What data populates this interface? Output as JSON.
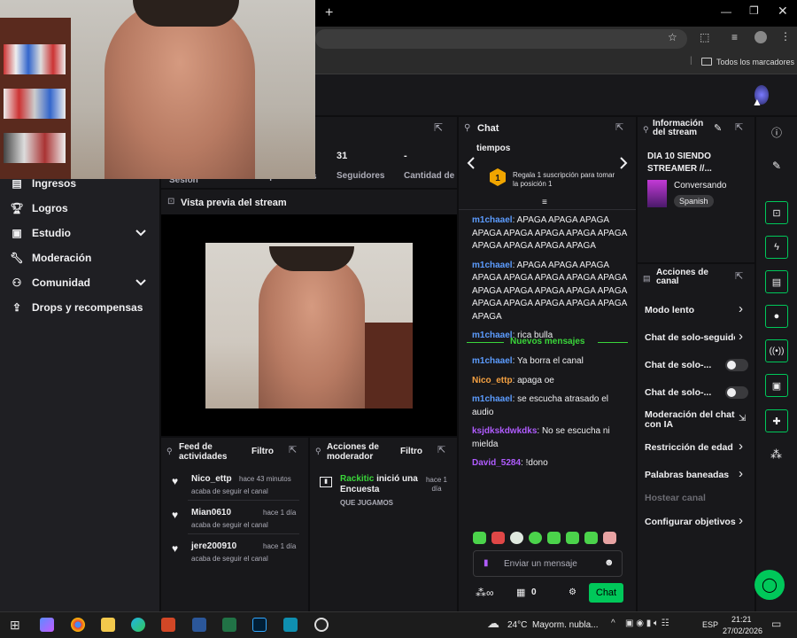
{
  "browser": {
    "new_tab_icon": "plus-icon",
    "bookmarks_label": "Todos los marcadores"
  },
  "stats": {
    "session_label": "Sesión",
    "spectators_label": "Espectadores",
    "followers_value": "31",
    "followers_label": "Seguidores",
    "subs_value": "-",
    "subs_label": "Cantidad de suscripciones"
  },
  "sidebar": {
    "items": [
      {
        "label": "Ingresos",
        "icon": "revenue-icon"
      },
      {
        "label": "Logros",
        "icon": "trophy-icon"
      },
      {
        "label": "Estudio",
        "icon": "studio-icon"
      },
      {
        "label": "Moderación",
        "icon": "wrench-icon"
      },
      {
        "label": "Comunidad",
        "icon": "community-icon"
      },
      {
        "label": "Drops y recompensas",
        "icon": "drops-icon"
      }
    ]
  },
  "preview": {
    "title": "Vista previa del stream"
  },
  "activity": {
    "title": "Feed de actividades",
    "filter_label": "Filtro",
    "items": [
      {
        "user": "Nico_ettp",
        "time": "hace 43 minutos",
        "action": "acaba de seguir el canal"
      },
      {
        "user": "Mian0610",
        "time": "hace 1 día",
        "action": "acaba de seguir el canal"
      },
      {
        "user": "jere200910",
        "time": "hace 1 día",
        "action": "acaba de seguir el canal"
      }
    ]
  },
  "mod_actions": {
    "title": "Acciones de moderador",
    "filter_label": "Filtro",
    "user": "Rackitic",
    "action": "inició una Encuesta",
    "time": "hace 1 día",
    "detail": "QUE JUGAMOS"
  },
  "chat": {
    "title": "Chat",
    "top_partial": "tiempos",
    "promo_text": "Regala 1 suscripción para tomar la posición 1",
    "promo_rank": "1",
    "new_messages_label": "Nuevos mensajes",
    "messages_before": [
      {
        "user": "m1chaael",
        "color": "#5c9cff",
        "text": "APAGA APAGA APAGA APAGA APAGA APAGA APAGA APAGA APAGA APAGA APAGA APAGA"
      },
      {
        "user": "m1chaael",
        "color": "#5c9cff",
        "text": "APAGA APAGA APAGA APAGA APAGA APAGA APAGA APAGA APAGA APAGA APAGA APAGA APAGA APAGA APAGA APAGA APAGA APAGA APAGA"
      },
      {
        "user": "m1chaael",
        "color": "#5c9cff",
        "text": "rica bulla"
      }
    ],
    "messages_after": [
      {
        "user": "m1chaael",
        "color": "#5c9cff",
        "text": "Ya borra el canal"
      },
      {
        "user": "Nico_ettp",
        "color": "#f5a142",
        "text": "apaga oe"
      },
      {
        "user": "m1chaael",
        "color": "#5c9cff",
        "text": "se escucha atrasado el audio"
      },
      {
        "user": "ksjdkskdwkdks",
        "color": "#b05cff",
        "text": "No se escucha ni mielda"
      },
      {
        "user": "David_5284",
        "color": "#b05cff",
        "text": "!dono"
      }
    ],
    "input_placeholder": "Enviar un mensaje",
    "points_value": "0",
    "send_label": "Chat"
  },
  "stream_info": {
    "title": "Información del stream",
    "stream_title": "DIA 10 SIENDO STREAMER //...",
    "category": "Conversando",
    "language": "Spanish"
  },
  "channel_actions": {
    "title": "Acciones de canal",
    "slow_mode": "Modo lento",
    "followers_only": "Chat de solo-seguido",
    "sub_only": "Chat de solo-...",
    "emote_only": "Chat de solo-...",
    "ai_mod": "Moderación del chat con IA",
    "age_restriction": "Restricción de edad",
    "banned_words": "Palabras baneadas",
    "host": "Hostear canal",
    "goals": "Configurar objetivos"
  },
  "taskbar": {
    "temperature": "24°C",
    "weather": "Mayorm. nubla...",
    "language": "ESP",
    "time": "21:21",
    "date": "27/02/2026"
  },
  "colors": {
    "accent_green": "#00c85a",
    "bg_dark": "#0e0e10",
    "panel": "#18181b",
    "new_messages_line": "#3ad63a"
  }
}
